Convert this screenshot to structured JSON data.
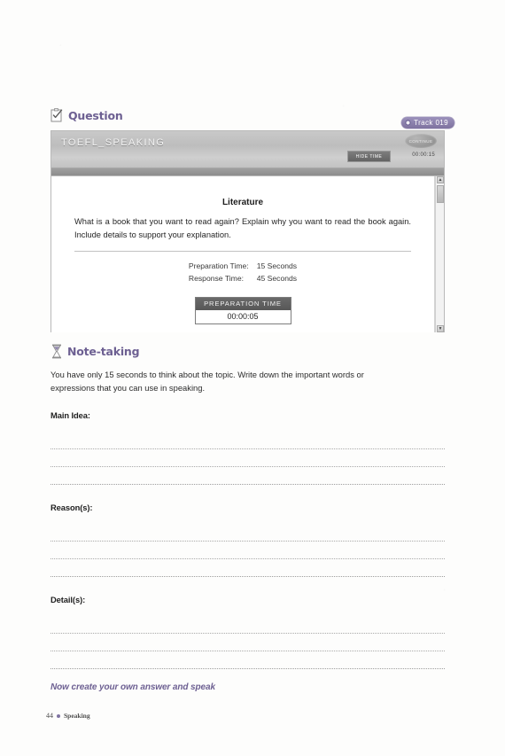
{
  "question_section": {
    "icon": "clipboard-check-icon",
    "title": "Question",
    "track": {
      "icon": "cd-dot-icon",
      "label": "Track 019"
    }
  },
  "toefl_window": {
    "title": "TOEFL_SPEAKING",
    "continue_label": "CONTINUE",
    "hide_time_label": "HIDE TIME",
    "clock": "00:00:15",
    "topic": "Literature",
    "prompt": "What is a book that you want to read again? Explain why you want to read the book again. Include details to support your explanation.",
    "times": [
      {
        "label": "Preparation Time:",
        "value": "15 Seconds"
      },
      {
        "label": "Response Time:",
        "value": "45 Seconds"
      }
    ],
    "prep_timer": {
      "label": "PREPARATION TIME",
      "value": "00:00:05"
    },
    "scrollbar": {
      "up_arrow": "▲",
      "down_arrow": "▼"
    }
  },
  "notetaking_section": {
    "icon": "hourglass-icon",
    "title": "Note-taking",
    "instructions": "You have only 15 seconds to think about the topic. Write down the important words or expressions that you can use in speaking.",
    "blocks": [
      {
        "label": "Main Idea:",
        "lines": 3
      },
      {
        "label": "Reason(s):",
        "lines": 3
      },
      {
        "label": "Detail(s):",
        "lines": 3
      }
    ]
  },
  "closing_note": "Now create your own answer and speak",
  "footer": {
    "page_number": "44",
    "section": "Speaking"
  },
  "colors": {
    "accent_purple": "#6d6092",
    "window_header_grey": "#c4c4c4",
    "timer_dark": "#5f5f5f"
  }
}
